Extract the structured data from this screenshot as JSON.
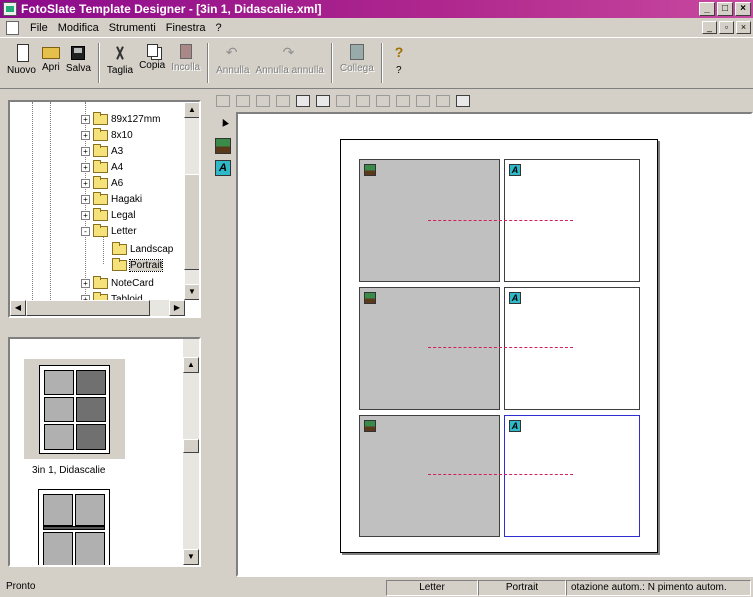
{
  "window": {
    "title": "FotoSlate Template Designer - [3in 1, Didascalie.xml]"
  },
  "menu": {
    "items": [
      "File",
      "Modifica",
      "Strumenti",
      "Finestra",
      "?"
    ]
  },
  "toolbar": {
    "buttons": [
      {
        "label": "Nuovo",
        "icon": "new-document-icon",
        "enabled": true
      },
      {
        "label": "Apri",
        "icon": "open-folder-icon",
        "enabled": true
      },
      {
        "label": "Salva",
        "icon": "floppy-disk-icon",
        "enabled": true
      },
      {
        "label": "Taglia",
        "icon": "scissors-icon",
        "enabled": true
      },
      {
        "label": "Copia",
        "icon": "copy-icon",
        "enabled": true
      },
      {
        "label": "Incolla",
        "icon": "paste-icon",
        "enabled": false
      },
      {
        "label": "Annulla",
        "icon": "undo-icon",
        "enabled": false
      },
      {
        "label": "Annulla annulla",
        "icon": "redo-icon",
        "enabled": false
      },
      {
        "label": "Collega",
        "icon": "link-icon",
        "enabled": false
      },
      {
        "label": "?",
        "icon": "help-icon",
        "enabled": true
      }
    ]
  },
  "tree": {
    "items": [
      {
        "label": "89x127mm",
        "expander": "+"
      },
      {
        "label": "8x10",
        "expander": "+"
      },
      {
        "label": "A3",
        "expander": "+"
      },
      {
        "label": "A4",
        "expander": "+"
      },
      {
        "label": "A6",
        "expander": "+"
      },
      {
        "label": "Hagaki",
        "expander": "+"
      },
      {
        "label": "Legal",
        "expander": "+"
      },
      {
        "label": "Letter",
        "expander": "-"
      },
      {
        "label": "Landscap",
        "expander": ""
      },
      {
        "label": "Portrait",
        "expander": "",
        "selected": true
      },
      {
        "label": "NoteCard",
        "expander": "+"
      },
      {
        "label": "Tabloid",
        "expander": "+"
      }
    ]
  },
  "templates": {
    "items": [
      {
        "label": "3in 1, Didascalie"
      }
    ]
  },
  "statusbar": {
    "message": "Pronto",
    "paper": "Letter",
    "orientation": "Portrait",
    "auto": "otazione autom.: N pimento autom."
  }
}
